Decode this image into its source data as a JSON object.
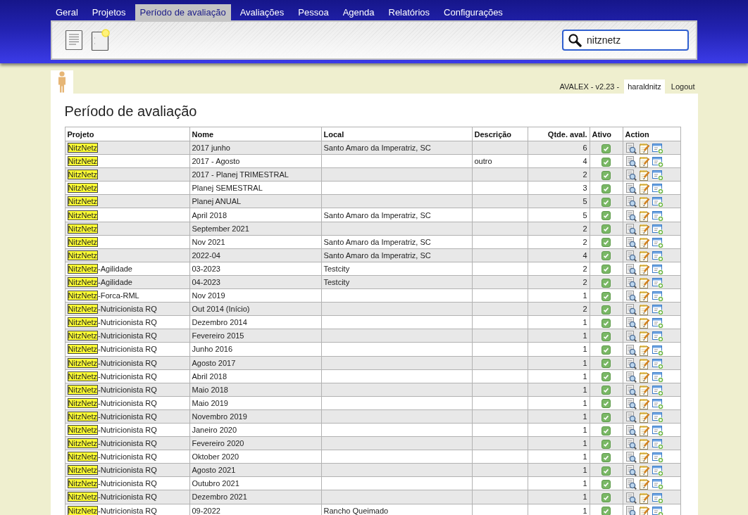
{
  "nav": {
    "tabs": [
      {
        "label": "Geral",
        "selected": false
      },
      {
        "label": "Projetos",
        "selected": false
      },
      {
        "label": "Período de avaliação",
        "selected": true
      },
      {
        "label": "Avaliações",
        "selected": false
      },
      {
        "label": "Pessoa",
        "selected": false
      },
      {
        "label": "Agenda",
        "selected": false
      },
      {
        "label": "Relatórios",
        "selected": false
      },
      {
        "label": "Configurações",
        "selected": false
      }
    ]
  },
  "toolbar": {
    "search": {
      "value": "nitznetz"
    }
  },
  "user_bar": {
    "version": "AVALEX - v2.23 -",
    "user": "haraldnitz",
    "logout": "Logout"
  },
  "page": {
    "title": "Período de avaliação"
  },
  "table": {
    "columns": [
      "Projeto",
      "Nome",
      "Local",
      "Descrição",
      "Qtde. aval.",
      "Ativo",
      "Action"
    ],
    "rows": [
      {
        "project_match": "NitzNetz",
        "name": "2017 junho",
        "local": "Santo Amaro da Imperatriz, SC",
        "count": "6",
        "active": true
      },
      {
        "project_match": "NitzNetz",
        "name": "2017 - Agosto",
        "description": "outro",
        "count": "4",
        "active": true
      },
      {
        "project_match": "NitzNetz",
        "name": "2017 - Planej TRIMESTRAL",
        "count": "2",
        "active": true
      },
      {
        "project_match": "NitzNetz",
        "name": "Planej SEMESTRAL",
        "count": "3",
        "active": true
      },
      {
        "project_match": "NitzNetz",
        "name": "Planej ANUAL",
        "count": "5",
        "active": true
      },
      {
        "project_match": "NitzNetz",
        "name": "April 2018",
        "local": "Santo Amaro da Imperatriz, SC",
        "count": "5",
        "active": true
      },
      {
        "project_match": "NitzNetz",
        "name": "September 2021",
        "count": "2",
        "active": true
      },
      {
        "project_match": "NitzNetz",
        "name": "Nov 2021",
        "local": "Santo Amaro da Imperatriz, SC",
        "count": "2",
        "active": true
      },
      {
        "project_match": "NitzNetz",
        "name": "2022-04",
        "local": "Santo Amaro da Imperatriz, SC",
        "count": "4",
        "active": true
      },
      {
        "project_match": "NitzNetz",
        "project_rest": "-Agilidade",
        "name": "03-2023",
        "local": "Testcity",
        "count": "2",
        "active": true
      },
      {
        "project_match": "NitzNetz",
        "project_rest": "-Agilidade",
        "name": "04-2023",
        "local": "Testcity",
        "count": "2",
        "active": true
      },
      {
        "project_match": "NitzNetz",
        "project_rest": "-Forca-RML",
        "name": "Nov 2019",
        "count": "1",
        "active": true
      },
      {
        "project_match": "NitzNetz",
        "project_rest": "-Nutricionista RQ",
        "name": "Out 2014 (Início)",
        "count": "2",
        "active": true
      },
      {
        "project_match": "NitzNetz",
        "project_rest": "-Nutricionista RQ",
        "name": "Dezembro 2014",
        "count": "1",
        "active": true
      },
      {
        "project_match": "NitzNetz",
        "project_rest": "-Nutricionista RQ",
        "name": "Fevereiro 2015",
        "count": "1",
        "active": true
      },
      {
        "project_match": "NitzNetz",
        "project_rest": "-Nutricionista RQ",
        "name": "Junho 2016",
        "count": "1",
        "active": true
      },
      {
        "project_match": "NitzNetz",
        "project_rest": "-Nutricionista RQ",
        "name": "Agosto 2017",
        "count": "1",
        "active": true
      },
      {
        "project_match": "NitzNetz",
        "project_rest": "-Nutricionista RQ",
        "name": "Abril 2018",
        "count": "1",
        "active": true
      },
      {
        "project_match": "NitzNetz",
        "project_rest": "-Nutricionista RQ",
        "name": "Maio 2018",
        "count": "1",
        "active": true
      },
      {
        "project_match": "NitzNetz",
        "project_rest": "-Nutricionista RQ",
        "name": "Maio 2019",
        "count": "1",
        "active": true
      },
      {
        "project_match": "NitzNetz",
        "project_rest": "-Nutricionista RQ",
        "name": "Novembro 2019",
        "count": "1",
        "active": true
      },
      {
        "project_match": "NitzNetz",
        "project_rest": "-Nutricionista RQ",
        "name": "Janeiro 2020",
        "count": "1",
        "active": true
      },
      {
        "project_match": "NitzNetz",
        "project_rest": "-Nutricionista RQ",
        "name": "Fevereiro 2020",
        "count": "1",
        "active": true
      },
      {
        "project_match": "NitzNetz",
        "project_rest": "-Nutricionista RQ",
        "name": "Oktober 2020",
        "count": "1",
        "active": true
      },
      {
        "project_match": "NitzNetz",
        "project_rest": "-Nutricionista RQ",
        "name": "Agosto 2021",
        "count": "1",
        "active": true
      },
      {
        "project_match": "NitzNetz",
        "project_rest": "-Nutricionista RQ",
        "name": "Outubro 2021",
        "count": "1",
        "active": true
      },
      {
        "project_match": "NitzNetz",
        "project_rest": "-Nutricionista RQ",
        "name": "Dezembro 2021",
        "count": "1",
        "active": true
      },
      {
        "project_match": "NitzNetz",
        "project_rest": "-Nutricionista RQ",
        "name": "09-2022",
        "local": "Rancho Queimado",
        "count": "1",
        "active": true
      }
    ]
  }
}
